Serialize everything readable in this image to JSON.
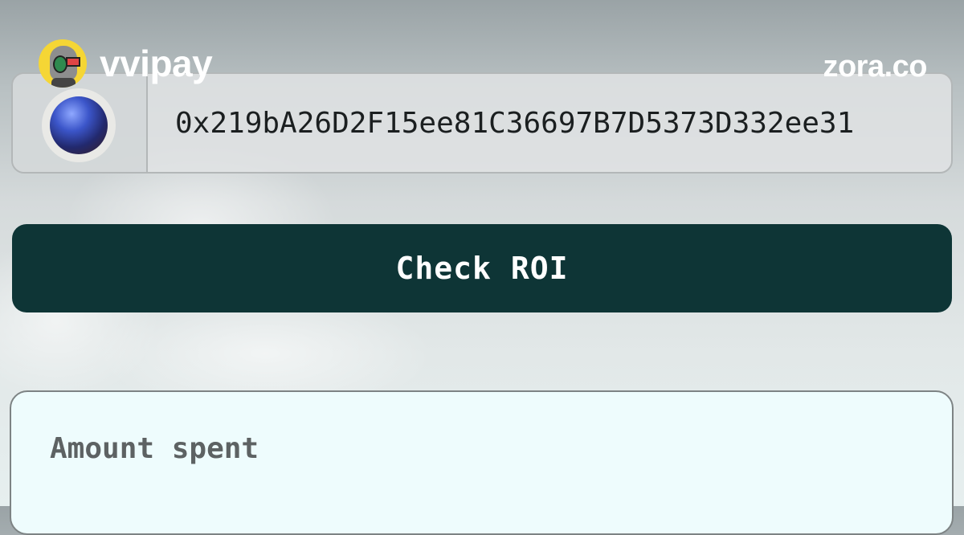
{
  "brand": {
    "name": "vvipay",
    "avatar_icon": "robot-avatar-icon"
  },
  "site": {
    "domain": "zora.co"
  },
  "address_input": {
    "value": "0x219bA26D2F15ee81C36697B7D5373D332ee31",
    "token_icon": "blue-orb-icon"
  },
  "check_button": {
    "label": "Check ROI"
  },
  "results_card": {
    "label": "Amount spent"
  },
  "colors": {
    "button_bg": "#0e3536",
    "card_bg": "#eefcfd",
    "text_white": "#ffffff"
  }
}
